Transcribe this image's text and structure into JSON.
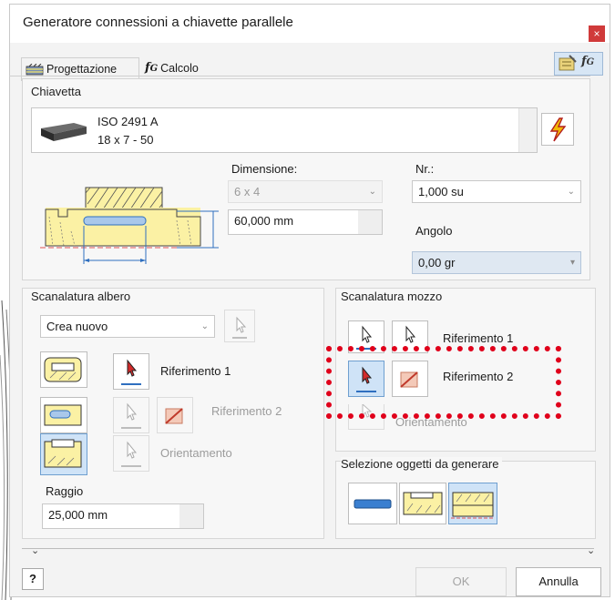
{
  "window": {
    "title": "Generatore connessioni a chiavette parallele",
    "close_glyph": "×"
  },
  "tabs": [
    {
      "label": "Progettazione",
      "icon": "design-tab-icon"
    },
    {
      "label": "Calcolo",
      "icon": "fx-calc-icon"
    }
  ],
  "key_group": {
    "label": "Chiavetta",
    "item_name": "ISO 2491 A",
    "item_size": "18 x 7 - 50"
  },
  "dimension": {
    "label": "Dimensione:",
    "value": "6 x 4"
  },
  "length": {
    "value": "60,000 mm"
  },
  "nr": {
    "label": "Nr.:",
    "value": "1,000 su"
  },
  "angle": {
    "label": "Angolo",
    "value": "0,00 gr"
  },
  "shaft_groove": {
    "label": "Scanalatura albero",
    "mode_value": "Crea nuovo",
    "ref1": "Riferimento 1",
    "ref2": "Riferimento 2",
    "orient": "Orientamento",
    "radius_label": "Raggio",
    "radius_value": "25,000 mm"
  },
  "hub_groove": {
    "label": "Scanalatura mozzo",
    "ref1": "Riferimento 1",
    "ref2": "Riferimento 2",
    "orient": "Orientamento"
  },
  "generate": {
    "label": "Selezione oggetti da generare"
  },
  "footer": {
    "help": "?",
    "ok": "OK",
    "cancel": "Annulla"
  },
  "colors": {
    "accent": "#2f6fbf",
    "highlight": "#e0001b",
    "close": "#d03a3a"
  }
}
